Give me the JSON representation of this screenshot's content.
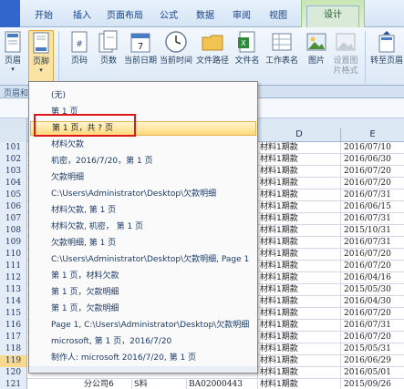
{
  "tabs": [
    "开始",
    "插入",
    "页面布局",
    "公式",
    "数据",
    "审阅",
    "视图",
    "设计"
  ],
  "ribbon": {
    "buttons": [
      "页眉",
      "页脚",
      "页码",
      "页数",
      "当前日期",
      "当前时间",
      "文件路径",
      "文件名",
      "工作表名",
      "图片",
      "设置图片格式",
      "转至页眉"
    ],
    "group_label": "页眉和"
  },
  "columns": [
    "D",
    "E"
  ],
  "dropdown": {
    "items": [
      "(无)",
      "第 1 页",
      "第 1 页，共 ? 页",
      "材料欠款",
      " 机密，2016/7/20，第 1 页",
      "欠款明细",
      "C:\\Users\\Administrator\\Desktop\\欠款明细",
      "材料欠款, 第 1 页",
      "材料欠款, 机密， 第 1 页",
      "欠款明细, 第 1 页",
      "C:\\Users\\Administrator\\Desktop\\欠款明细, Page 1",
      "第 1 页，材料欠款",
      "第 1 页，欠款明细",
      "第 1 页，欠款明细",
      "Page 1, C:\\Users\\Administrator\\Desktop\\欠款明细",
      "microsoft, 第 1 页，2016/7/20",
      "制作人: microsoft 2016/7/20,  第 1 页"
    ],
    "highlight_index": 2
  },
  "rows": [
    {
      "num": "101",
      "c": "材料1期款",
      "d": "2016/07/10"
    },
    {
      "num": "102",
      "c": "材料1期款",
      "d": "2016/06/30"
    },
    {
      "num": "103",
      "c": "材料1期款",
      "d": "2016/07/20"
    },
    {
      "num": "104",
      "c": "材料1期款",
      "d": "2016/07/20"
    },
    {
      "num": "105",
      "c": "材料1期款",
      "d": "2016/07/31"
    },
    {
      "num": "106",
      "c": "材料1期款",
      "d": "2016/06/15"
    },
    {
      "num": "107",
      "c": "材料1期款",
      "d": "2016/07/31"
    },
    {
      "num": "108",
      "c": "材料1期款",
      "d": "2015/10/31"
    },
    {
      "num": "109",
      "c": "材料1期款",
      "d": "2016/07/31"
    },
    {
      "num": "110",
      "c": "材料1期款",
      "d": "2016/07/20"
    },
    {
      "num": "111",
      "c": "材料1期款",
      "d": "2016/07/20"
    },
    {
      "num": "112",
      "c": "材料1期款",
      "d": "2016/04/16"
    },
    {
      "num": "113",
      "c": "材料1期款",
      "d": "2015/05/30"
    },
    {
      "num": "114",
      "c": "材料1期款",
      "d": "2016/04/30"
    },
    {
      "num": "115",
      "c": "材料1期款",
      "d": "2016/07/20"
    },
    {
      "num": "116",
      "c": "材料1期款",
      "d": "2016/07/31"
    },
    {
      "num": "117",
      "c": "材料1期款",
      "d": "2016/07/20"
    },
    {
      "num": "118",
      "c": "材料1期款",
      "d": "2015/05/31"
    },
    {
      "num": "119",
      "c": "材料1期款",
      "d": "2016/06/29"
    },
    {
      "num": "120",
      "c": "材料1期款",
      "d": "2016/05/01"
    },
    {
      "num": "121",
      "c": "材料1期款",
      "d": "2015/09/26",
      "a": "分公司6",
      "b": "S料",
      "e": "BA02000443"
    }
  ],
  "selected_row": "119"
}
